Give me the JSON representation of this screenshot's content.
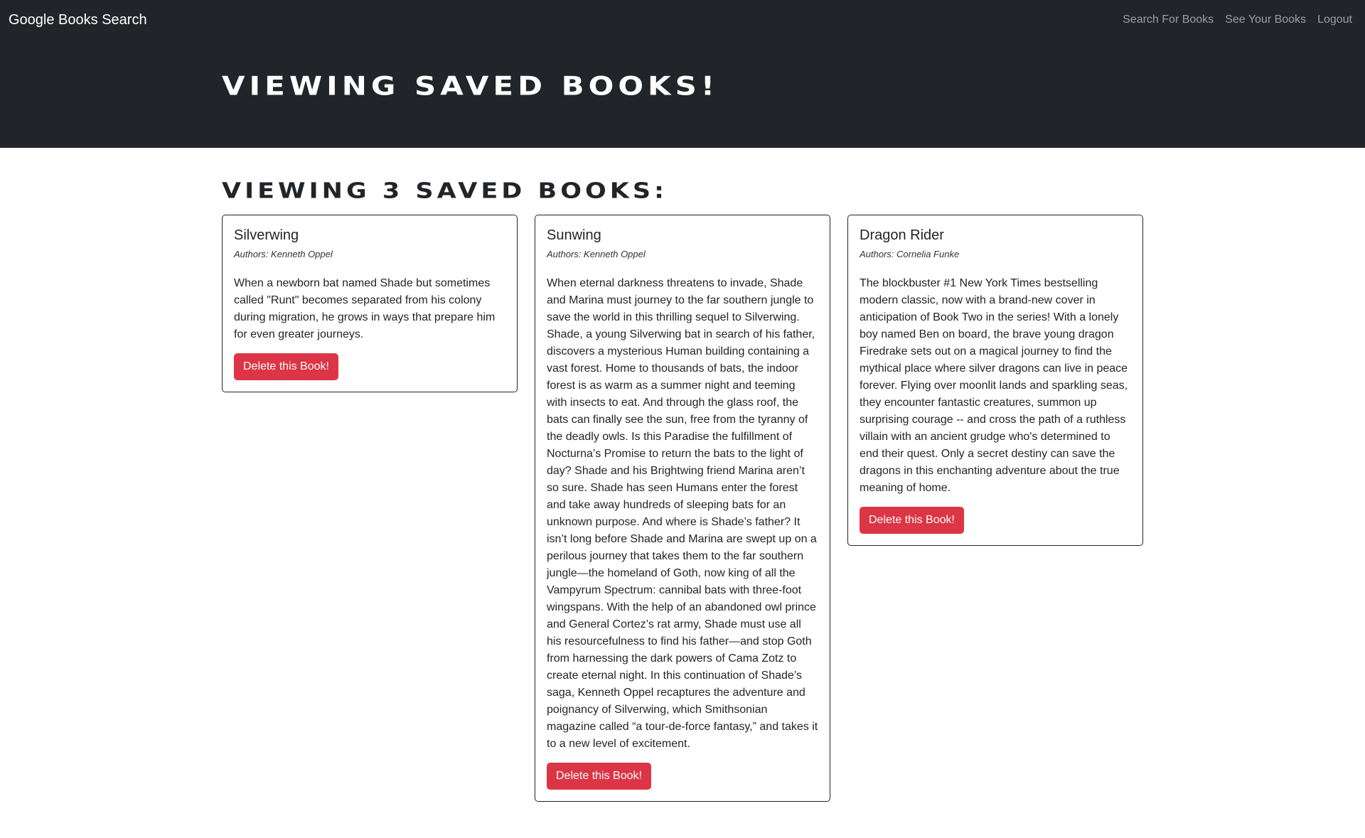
{
  "navbar": {
    "brand": "Google Books Search",
    "links": [
      "Search For Books",
      "See Your Books",
      "Logout"
    ]
  },
  "hero": {
    "title": "Viewing saved books!"
  },
  "main": {
    "count_title": "Viewing 3 saved books:",
    "books": [
      {
        "title": "Silverwing",
        "authors": "Authors: Kenneth Oppel",
        "description": "When a newborn bat named Shade but sometimes called \"Runt\" becomes separated from his colony during migration, he grows in ways that prepare him for even greater journeys.",
        "delete_label": "Delete this Book!"
      },
      {
        "title": "Sunwing",
        "authors": "Authors: Kenneth Oppel",
        "description": "When eternal darkness threatens to invade, Shade and Marina must journey to the far southern jungle to save the world in this thrilling sequel to Silverwing. Shade, a young Silverwing bat in search of his father, discovers a mysterious Human building containing a vast forest. Home to thousands of bats, the indoor forest is as warm as a summer night and teeming with insects to eat. And through the glass roof, the bats can finally see the sun, free from the tyranny of the deadly owls. Is this Paradise the fulfillment of Nocturna’s Promise to return the bats to the light of day? Shade and his Brightwing friend Marina aren’t so sure. Shade has seen Humans enter the forest and take away hundreds of sleeping bats for an unknown purpose. And where is Shade’s father? It isn’t long before Shade and Marina are swept up on a perilous journey that takes them to the far southern jungle—the homeland of Goth, now king of all the Vampyrum Spectrum: cannibal bats with three-foot wingspans. With the help of an abandoned owl prince and General Cortez’s rat army, Shade must use all his resourcefulness to find his father—and stop Goth from harnessing the dark powers of Cama Zotz to create eternal night. In this continuation of Shade’s saga, Kenneth Oppel recaptures the adventure and poignancy of Silverwing, which Smithsonian magazine called “a tour-de-force fantasy,” and takes it to a new level of excitement.",
        "delete_label": "Delete this Book!"
      },
      {
        "title": "Dragon Rider",
        "authors": "Authors: Cornelia Funke",
        "description": "The blockbuster #1 New York Times bestselling modern classic, now with a brand-new cover in anticipation of Book Two in the series! With a lonely boy named Ben on board, the brave young dragon Firedrake sets out on a magical journey to find the mythical place where silver dragons can live in peace forever. Flying over moonlit lands and sparkling seas, they encounter fantastic creatures, summon up surprising courage -- and cross the path of a ruthless villain with an ancient grudge who's determined to end their quest. Only a secret destiny can save the dragons in this enchanting adventure about the true meaning of home.",
        "delete_label": "Delete this Book!"
      }
    ]
  },
  "colors": {
    "dark": "#212529",
    "danger": "#dc3545",
    "nav_link": "#8c8e91"
  }
}
